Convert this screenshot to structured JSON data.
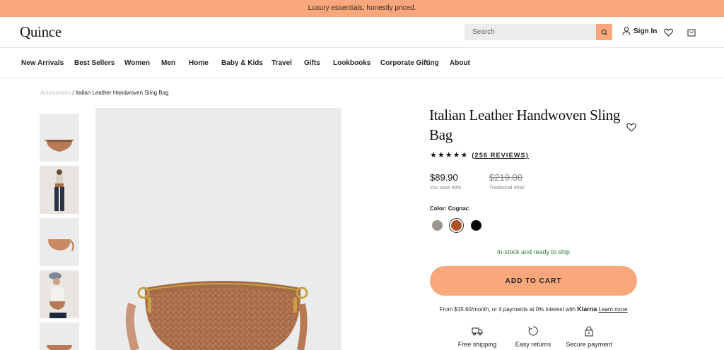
{
  "promo": {
    "text": "Luxury essentials, honestly priced."
  },
  "header": {
    "logo": "Quince",
    "search_placeholder": "Search",
    "signin_label": "Sign In",
    "icons": [
      "search-icon",
      "user-icon",
      "heart-icon",
      "cart-icon"
    ]
  },
  "nav": {
    "items": [
      "New Arrivals",
      "Best Sellers",
      "Women",
      "Men",
      "Home",
      "Baby & Kids",
      "Travel",
      "Gifts",
      "Lookbooks",
      "Corporate Gifting",
      "About"
    ]
  },
  "breadcrumb": {
    "parent": "Accessories",
    "separator": "/",
    "current": "Italian Leather Handwoven Sling Bag"
  },
  "product": {
    "title": "Italian Leather Handwoven Sling Bag",
    "stars": "★★★★★",
    "reviews": "(256 REVIEWS)",
    "rating": 5,
    "price": "$89.90",
    "savings": "You save 59%",
    "retail_price": "$219.00",
    "retail_label": "Traditional retail",
    "color_label": "Color: Cognac",
    "swatches": [
      {
        "name": "Grey",
        "color": "#9a9690",
        "selected": false
      },
      {
        "name": "Cognac",
        "color": "#b0521f",
        "selected": true
      },
      {
        "name": "Black",
        "color": "#0a0a0a",
        "selected": false
      }
    ],
    "stock_status": "In-stock and ready to ship",
    "add_to_cart": "ADD TO CART",
    "financing": {
      "text": "From $15.60/month, or 4 payments at 0% interest with",
      "provider": "Klarna",
      "link": "Learn more"
    },
    "perks": [
      {
        "label": "Free shipping",
        "icon": "truck-icon"
      },
      {
        "label": "Easy returns",
        "icon": "return-icon"
      },
      {
        "label": "Secure payment",
        "icon": "lock-icon"
      }
    ]
  },
  "colors": {
    "accent": "#f9a77b",
    "stock": "#2e7d3a",
    "image_bg": "#ebebeb",
    "leather": "#b87a55"
  }
}
